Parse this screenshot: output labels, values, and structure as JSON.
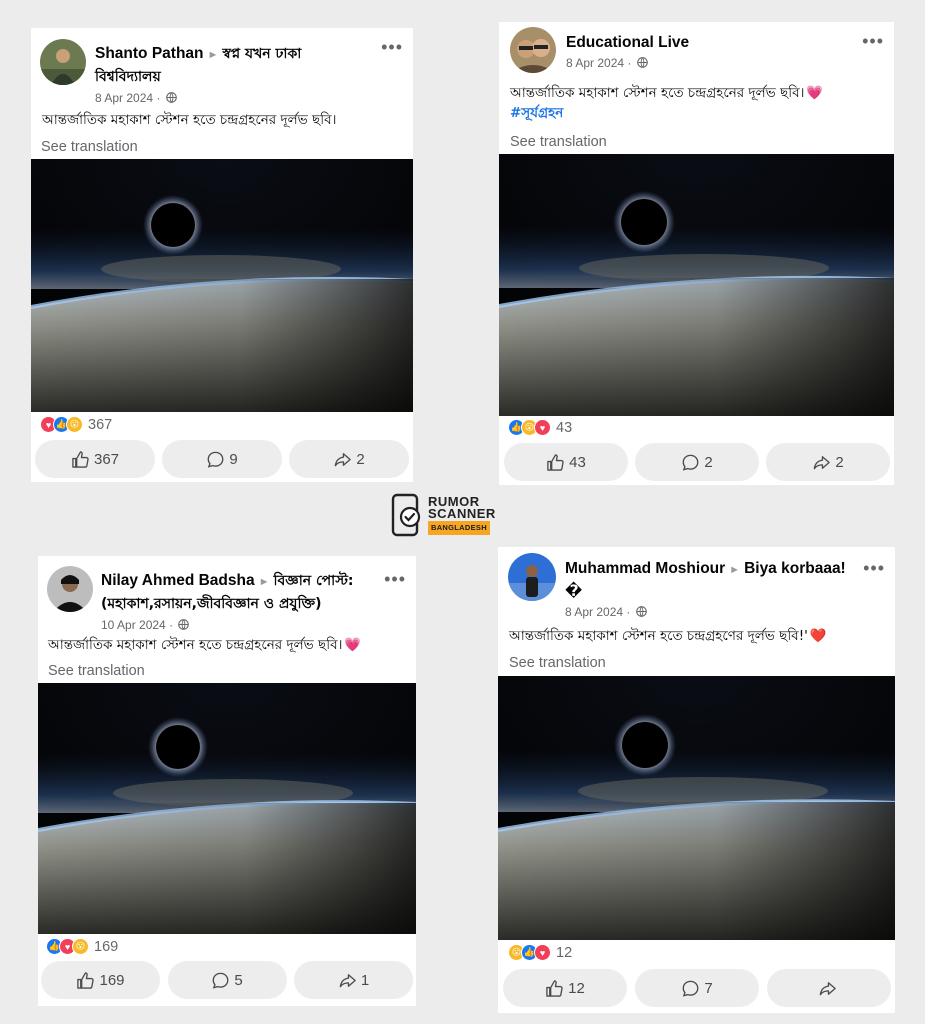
{
  "posts": [
    {
      "author": "Shanto Pathan",
      "group": "স্বপ্ন যখন ঢাকা বিশ্ববিদ্যালয়",
      "date": "8 Apr 2024",
      "caption": "আন্তর্জাতিক মহাকাশ স্টেশন হতে চন্দ্রগ্রহনের দূর্লভ ছবি।",
      "hashtag": "",
      "emoji": "",
      "see_translation": "See translation",
      "reaction_count": "367",
      "reactions": [
        "love",
        "like",
        "wow"
      ],
      "likes": "367",
      "comments": "9",
      "shares": "2"
    },
    {
      "author": "Educational Live",
      "group": "",
      "date": "8 Apr 2024",
      "caption": "আন্তর্জাতিক মহাকাশ স্টেশন হতে চন্দ্রগ্রহনের দূর্লভ ছবি।",
      "hashtag": "#সূর্যগ্রহন",
      "emoji": "💗",
      "see_translation": "See translation",
      "reaction_count": "43",
      "reactions": [
        "like",
        "wow",
        "love"
      ],
      "likes": "43",
      "comments": "2",
      "shares": "2"
    },
    {
      "author": "Nilay Ahmed Badsha",
      "group": "বিজ্ঞান পোস্ট: (মহাকাশ,রসায়ন,জীববিজ্ঞান ও প্রযুক্তি)",
      "date": "10 Apr 2024",
      "caption": "আন্তর্জাতিক মহাকাশ স্টেশন হতে চন্দ্রগ্রহনের দূর্লভ ছবি।",
      "hashtag": "",
      "emoji": "💗",
      "see_translation": "See translation",
      "reaction_count": "169",
      "reactions": [
        "like",
        "love",
        "wow"
      ],
      "likes": "169",
      "comments": "5",
      "shares": "1"
    },
    {
      "author": "Muhammad Moshiour",
      "group": "Biya korbaaa! �",
      "date": "8 Apr 2024",
      "caption": "আন্তর্জাতিক মহাকাশ স্টেশন হতে চন্দ্রগ্রহণের দূর্লভ ছবি!'",
      "hashtag": "",
      "emoji": "❤️",
      "see_translation": "See translation",
      "reaction_count": "12",
      "reactions": [
        "wow",
        "like",
        "love"
      ],
      "likes": "12",
      "comments": "7",
      "shares": ""
    }
  ],
  "logo": {
    "line1": "RUMOR",
    "line2": "SCANNER",
    "line3": "BANGLADESH",
    "icon": "phone-check-icon"
  },
  "colors": {
    "background": "#ececec",
    "card": "#ffffff",
    "link_blue": "#1b74e4",
    "secondary_text": "#65676b",
    "button_bg": "#ededed",
    "logo_accent": "#f5a623"
  }
}
